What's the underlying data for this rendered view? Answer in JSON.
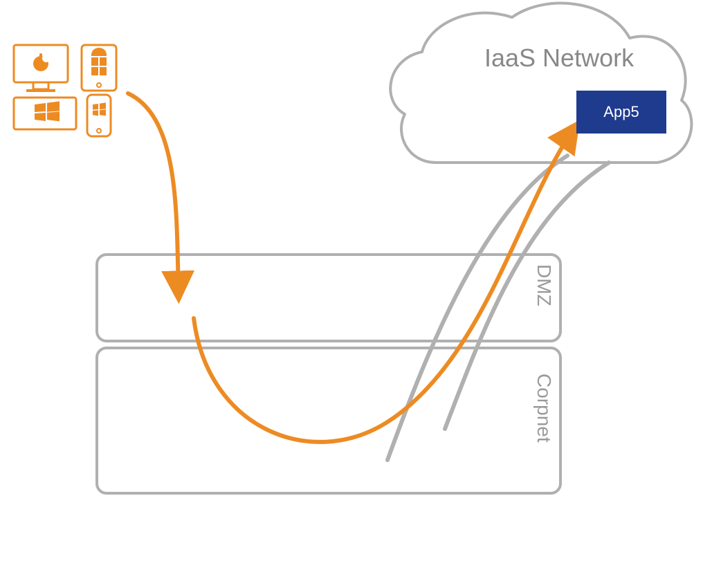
{
  "cloud": {
    "title": "IaaS Network",
    "app_label": "App5"
  },
  "zones": {
    "dmz": "DMZ",
    "corpnet": "Corpnet"
  },
  "colors": {
    "orange": "#ED8B23",
    "gray_line": "#B0B0B0",
    "gray_text": "#888888",
    "app_blue": "#1F3B8E"
  },
  "devices": {
    "kind": "client-devices",
    "items": [
      "desktop-mac",
      "tablet-android",
      "laptop-windows",
      "phone-windows"
    ]
  },
  "flow": {
    "description": "Client devices route down into DMZ/Corpnet and back up to App5 in the IaaS cloud."
  }
}
